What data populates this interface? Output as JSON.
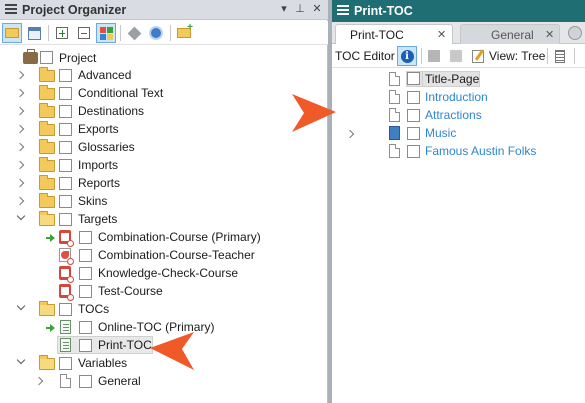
{
  "left_pane": {
    "title": "Project Organizer",
    "pin_icon": "pin-icon",
    "close_icon": "close-icon",
    "tree": {
      "root": "Project",
      "folders": [
        "Advanced",
        "Conditional Text",
        "Destinations",
        "Exports",
        "Glossaries",
        "Imports",
        "Reports",
        "Skins"
      ],
      "targets_label": "Targets",
      "targets": [
        "Combination-Course (Primary)",
        "Combination-Course-Teacher",
        "Knowledge-Check-Course",
        "Test-Course"
      ],
      "tocs_label": "TOCs",
      "tocs": [
        "Online-TOC (Primary)",
        "Print-TOC"
      ],
      "variables_label": "Variables",
      "variables": [
        "General"
      ]
    }
  },
  "right_pane": {
    "title": "Print-TOC",
    "tabs": [
      {
        "label": "Print-TOC",
        "close": "✕"
      },
      {
        "label": "General",
        "close": "✕"
      }
    ],
    "toolbar": {
      "editor_label": "TOC Editor",
      "info_glyph": "i",
      "view_label": "View: Tree"
    },
    "entries": {
      "title_page": "Title-Page",
      "links": [
        "Introduction",
        "Attractions",
        "Music",
        "Famous Austin Folks"
      ]
    }
  },
  "colors": {
    "accent_header": "#1f6e73",
    "link": "#2e86d1",
    "callout_arrow": "#f05a28"
  }
}
